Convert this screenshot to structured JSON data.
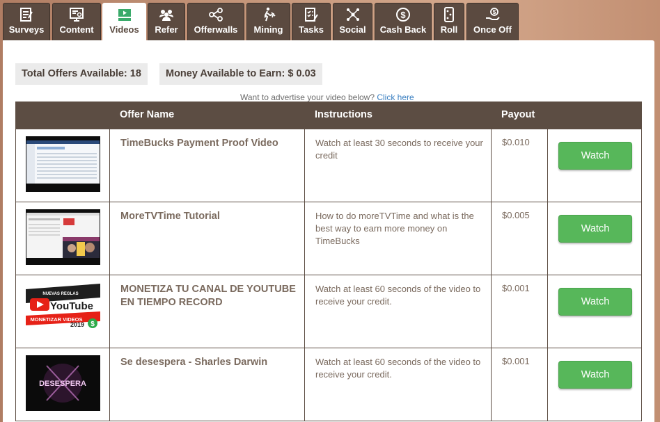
{
  "tabs": [
    {
      "label": "Surveys",
      "icon": "clipboard-icon"
    },
    {
      "label": "Content",
      "icon": "monitor-icon"
    },
    {
      "label": "Videos",
      "icon": "video-icon",
      "active": true
    },
    {
      "label": "Refer",
      "icon": "users-icon"
    },
    {
      "label": "Offerwalls",
      "icon": "share-nodes-icon"
    },
    {
      "label": "Mining",
      "icon": "pickaxe-icon"
    },
    {
      "label": "Tasks",
      "icon": "task-list-icon"
    },
    {
      "label": "Social",
      "icon": "network-icon"
    },
    {
      "label": "Cash Back",
      "icon": "dollar-cycle-icon"
    },
    {
      "label": "Roll",
      "icon": "dice-icon"
    },
    {
      "label": "Once Off",
      "icon": "coin-hand-icon"
    }
  ],
  "stats": {
    "total_offers": "Total Offers Available: 18",
    "money_available": "Money Available to Earn: $ 0.03"
  },
  "advertise": {
    "text": "Want to advertise your video below?",
    "link": "Click here"
  },
  "table": {
    "headers": {
      "offer_name": "Offer Name",
      "instructions": "Instructions",
      "payout": "Payout"
    },
    "rows": [
      {
        "name": "TimeBucks Payment Proof Video",
        "instructions": "Watch at least 30 seconds to receive your credit",
        "payout": "$0.010",
        "button": "Watch"
      },
      {
        "name": "MoreTVTime Tutorial",
        "instructions": "How to do moreTVTime and what is the best way to earn more money on TimeBucks",
        "payout": "$0.005",
        "button": "Watch"
      },
      {
        "name": "MONETIZA TU CANAL DE YOUTUBE EN TIEMPO RECORD",
        "instructions": "Watch at least 60 seconds of the video to receive your credit.",
        "payout": "$0.001",
        "button": "Watch"
      },
      {
        "name": "Se desespera - Sharles Darwin",
        "instructions": "Watch at least 60 seconds of the video to receive your credit.",
        "payout": "$0.001",
        "button": "Watch"
      }
    ]
  },
  "thumb3": {
    "top_text": "NUEVAS REGLAS",
    "brand": "YouTube",
    "bottom_text": "MONETIZAR VIDEOS",
    "year": "2019",
    "badge": "$"
  },
  "thumb4": {
    "text": "DESESPERA"
  },
  "colors": {
    "tab_bg": "#5b4a40",
    "header_bg": "#5c4d43",
    "watch_bg": "#57b75a",
    "link": "#3a7fc1"
  }
}
